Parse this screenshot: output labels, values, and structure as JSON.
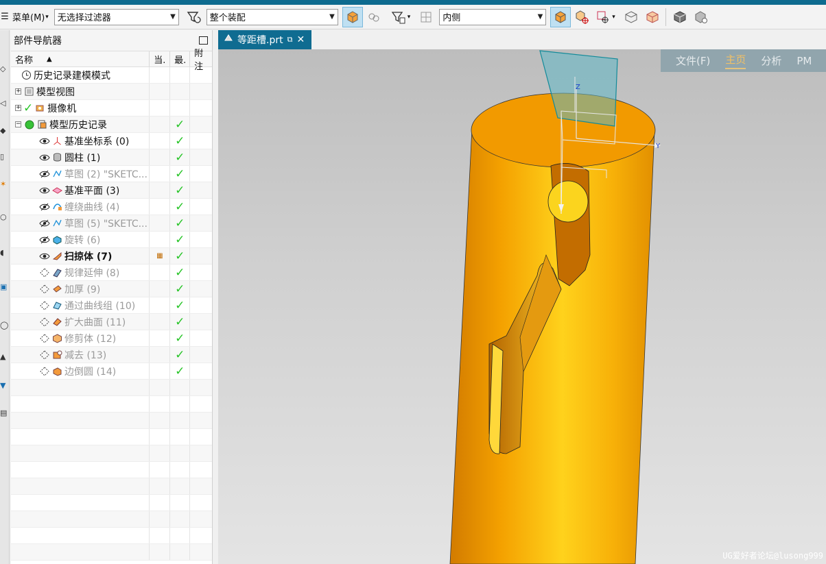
{
  "toolbar": {
    "menu_label": "菜单(M)",
    "filter_value": "无选择过滤器",
    "assembly_value": "整个装配",
    "side_value": "内侧"
  },
  "navigator": {
    "title": "部件导航器",
    "columns": {
      "name": "名称",
      "current": "当.",
      "latest": "最.",
      "notes": "附注"
    },
    "rows": [
      {
        "label": "历史记录建模模式",
        "icon": "clock-icon",
        "style": "normal",
        "indent": 1,
        "check": false
      },
      {
        "label": "模型视图",
        "icon": "model-views-icon",
        "style": "normal",
        "indent": 0,
        "expander": "+",
        "check": false
      },
      {
        "label": "摄像机",
        "icon": "camera-icon",
        "style": "normal",
        "indent": 0,
        "expander": "+",
        "check": false
      },
      {
        "label": "模型历史记录",
        "icon": "history-icon",
        "style": "normal",
        "indent": 0,
        "expander": "−",
        "check": true
      },
      {
        "label": "基准坐标系 (0)",
        "icon": "datum-csys-icon",
        "style": "normal",
        "indent": 2,
        "check": true
      },
      {
        "label": "圆柱 (1)",
        "icon": "cylinder-icon",
        "style": "normal",
        "indent": 2,
        "check": true
      },
      {
        "label": "草图 (2) \"SKETC...",
        "icon": "sketch-icon",
        "style": "grey",
        "indent": 2,
        "check": true
      },
      {
        "label": "基准平面 (3)",
        "icon": "datum-plane-icon",
        "style": "normal",
        "indent": 2,
        "check": true
      },
      {
        "label": "缠绕曲线 (4)",
        "icon": "wrap-curve-icon",
        "style": "grey",
        "indent": 2,
        "check": true
      },
      {
        "label": "草图 (5) \"SKETC...",
        "icon": "sketch-icon",
        "style": "grey",
        "indent": 2,
        "check": true
      },
      {
        "label": "旋转 (6)",
        "icon": "revolve-icon",
        "style": "grey",
        "indent": 2,
        "check": true
      },
      {
        "label": "扫掠体 (7)",
        "icon": "sweep-icon",
        "style": "bold",
        "indent": 2,
        "check": true,
        "current": true
      },
      {
        "label": "规律延伸 (8)",
        "icon": "law-extension-icon",
        "style": "grey",
        "indent": 2,
        "check": true
      },
      {
        "label": "加厚 (9)",
        "icon": "thicken-icon",
        "style": "grey",
        "indent": 2,
        "check": true
      },
      {
        "label": "通过曲线组 (10)",
        "icon": "through-curves-icon",
        "style": "grey",
        "indent": 2,
        "check": true
      },
      {
        "label": "扩大曲面 (11)",
        "icon": "enlarge-icon",
        "style": "grey",
        "indent": 2,
        "check": true
      },
      {
        "label": "修剪体 (12)",
        "icon": "trim-body-icon",
        "style": "grey",
        "indent": 2,
        "check": true
      },
      {
        "label": "减去 (13)",
        "icon": "subtract-icon",
        "style": "grey",
        "indent": 2,
        "check": true
      },
      {
        "label": "边倒圆 (14)",
        "icon": "edge-blend-icon",
        "style": "grey",
        "indent": 2,
        "check": true
      }
    ]
  },
  "document_tab": {
    "label": "等距槽.prt"
  },
  "ribbon": {
    "items": [
      "文件(F)",
      "主页",
      "分析",
      "PM"
    ],
    "active_index": 1
  },
  "viewport": {
    "axis_z": "Z",
    "axis_y": "Y",
    "part_color": "#f5a80a"
  },
  "watermark": "UG爱好者论坛@lusong999"
}
